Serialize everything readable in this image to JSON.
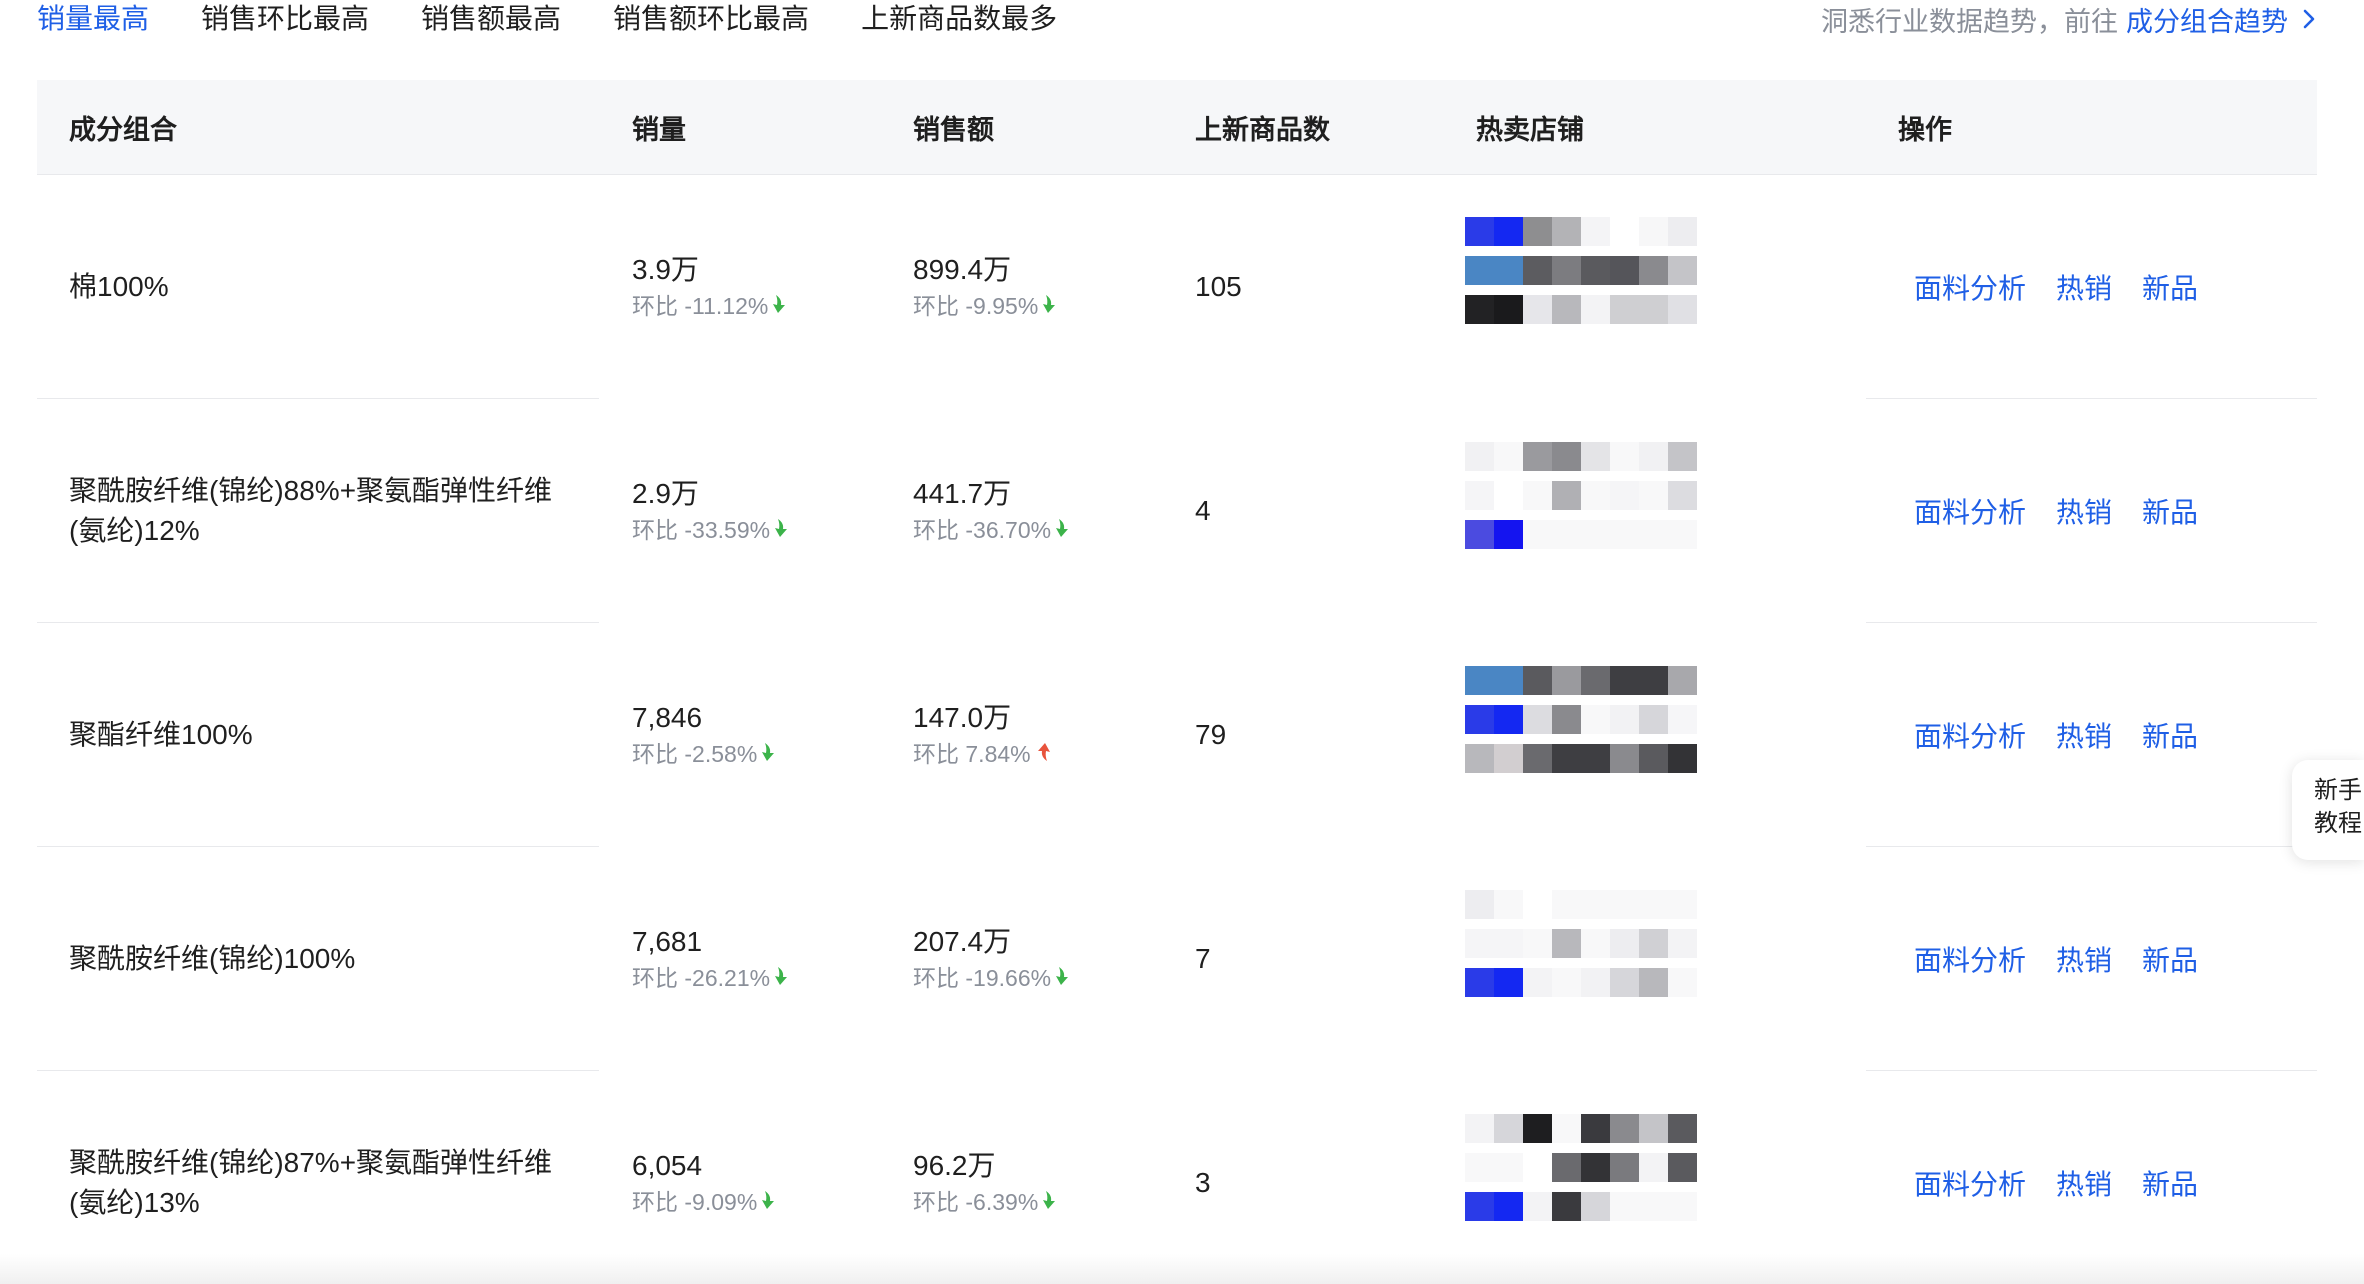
{
  "tabs": [
    {
      "label": "销量最高",
      "active": true
    },
    {
      "label": "销售环比最高",
      "active": false
    },
    {
      "label": "销售额最高",
      "active": false
    },
    {
      "label": "销售额环比最高",
      "active": false
    },
    {
      "label": "上新商品数最多",
      "active": false
    }
  ],
  "hint": {
    "text": "洞悉行业数据趋势，前往",
    "link": "成分组合趋势"
  },
  "table": {
    "headers": {
      "combo": "成分组合",
      "volume": "销量",
      "sales": "销售额",
      "new_items": "上新商品数",
      "shops": "热卖店铺",
      "ops": "操作"
    },
    "rows": [
      {
        "combo": "棉100%",
        "volume": "3.9万",
        "volume_change": "环比 -11.12%",
        "volume_dir": "down",
        "sales": "899.4万",
        "sales_change": "环比 -9.95%",
        "sales_dir": "down",
        "new_items": "105"
      },
      {
        "combo": "聚酰胺纤维(锦纶)88%+聚氨酯弹性纤维(氨纶)12%",
        "volume": "2.9万",
        "volume_change": "环比 -33.59%",
        "volume_dir": "down",
        "sales": "441.7万",
        "sales_change": "环比 -36.70%",
        "sales_dir": "down",
        "new_items": "4"
      },
      {
        "combo": "聚酯纤维100%",
        "volume": "7,846",
        "volume_change": "环比 -2.58%",
        "volume_dir": "down",
        "sales": "147.0万",
        "sales_change": "环比 7.84%",
        "sales_dir": "up",
        "new_items": "79"
      },
      {
        "combo": "聚酰胺纤维(锦纶)100%",
        "volume": "7,681",
        "volume_change": "环比 -26.21%",
        "volume_dir": "down",
        "sales": "207.4万",
        "sales_change": "环比 -19.66%",
        "sales_dir": "down",
        "new_items": "7"
      },
      {
        "combo": "聚酰胺纤维(锦纶)87%+聚氨酯弹性纤维(氨纶)13%",
        "volume": "6,054",
        "volume_change": "环比 -9.09%",
        "volume_dir": "down",
        "sales": "96.2万",
        "sales_change": "环比 -6.39%",
        "sales_dir": "down",
        "new_items": "3"
      }
    ],
    "ops": {
      "fabric": "面料分析",
      "hot": "热销",
      "new": "新品"
    }
  },
  "side_widget": {
    "line1": "新手",
    "line2": "教程"
  },
  "colors": {
    "accent": "#1f5fe6",
    "down": "#3cb34a",
    "up": "#e8533c",
    "muted": "#8a8f99"
  }
}
